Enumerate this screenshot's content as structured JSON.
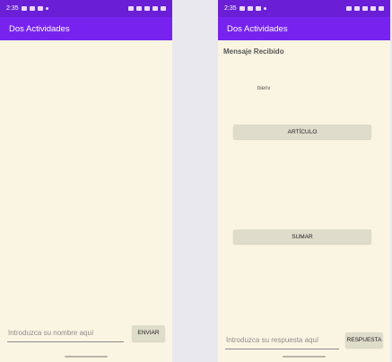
{
  "left_screen": {
    "status_time": "2:35",
    "app_title": "Dos Actividades",
    "name_input": {
      "placeholder": "Introduzca su nombre aquí",
      "value": ""
    },
    "send_button": "ENVIAR"
  },
  "right_screen": {
    "status_time": "2:35",
    "app_title": "Dos Actividades",
    "message_title": "Mensaje Recibido",
    "message_body": "bienv",
    "article_button": "ARTÍCULO",
    "sum_button": "SUMAR",
    "answer_input": {
      "placeholder": "Introduzca su respuesta aquí",
      "value": ""
    },
    "answer_button": "RESPUESTA"
  },
  "colors": {
    "status_bar": "#6a1fd6",
    "app_bar": "#7722ef",
    "background": "#faf5e2",
    "button": "#dedccb"
  }
}
